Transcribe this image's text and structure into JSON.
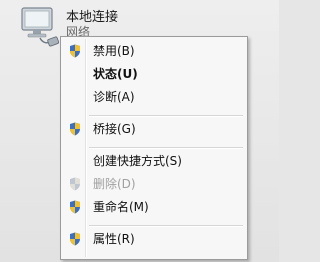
{
  "connection": {
    "title": "本地连接",
    "subtitle": "网络"
  },
  "menu": {
    "items": [
      {
        "label": "禁用(B)"
      },
      {
        "label": "状态(U)"
      },
      {
        "label": "诊断(A)"
      },
      {
        "label": "桥接(G)"
      },
      {
        "label": "创建快捷方式(S)"
      },
      {
        "label": "删除(D)"
      },
      {
        "label": "重命名(M)"
      },
      {
        "label": "属性(R)"
      }
    ]
  },
  "icons": {
    "connection": "network-connection-icon",
    "shield": "uac-shield-icon"
  },
  "colors": {
    "menu_bg": "#f7f7f7",
    "menu_border": "#9b9b9b",
    "disabled_text": "#a0a0a0"
  }
}
